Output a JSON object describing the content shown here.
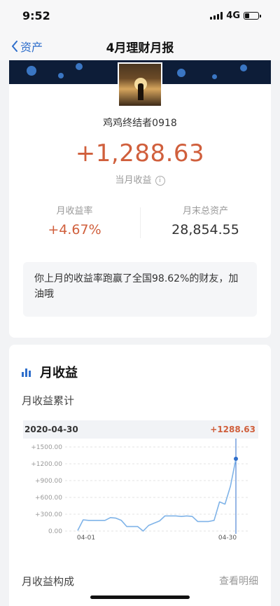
{
  "status_bar": {
    "time": "9:52",
    "network": "4G",
    "battery_level": 0.35
  },
  "nav": {
    "back_label": "资产",
    "title": "4月理财月报"
  },
  "summary": {
    "username": "鸡鸡终结者0918",
    "month_profit": "+1,288.63",
    "month_profit_label": "当月收益",
    "info_icon": "ⓘ",
    "return_rate_label": "月收益率",
    "return_rate": "+4.67%",
    "total_assets_label": "月末总资产",
    "total_assets": "28,854.55",
    "message": "你上月的收益率跑赢了全国98.62%的财友，加油哦"
  },
  "monthly_section": {
    "icon": "bar-chart-icon",
    "title": "月收益",
    "subtitle": "月收益累计",
    "bottom_title": "月收益构成",
    "bottom_link": "查看明细"
  },
  "chart_data": {
    "type": "line",
    "header_date": "2020-04-30",
    "header_value": "+1288.63",
    "y_ticks": [
      "+1500.00",
      "+1200.00",
      "+900.00",
      "+600.00",
      "+300.00",
      "0.00"
    ],
    "x_labels": [
      "04-01",
      "04-30"
    ],
    "ylim": [
      0,
      1500
    ],
    "line_color": "#7fb3e8",
    "series": [
      {
        "values": [
          10,
          200,
          190,
          190,
          190,
          190,
          240,
          230,
          190,
          80,
          80,
          80,
          0,
          100,
          140,
          180,
          270,
          270,
          270,
          260,
          270,
          260,
          170,
          170,
          170,
          190,
          520,
          480,
          800,
          1288.63
        ]
      }
    ]
  }
}
